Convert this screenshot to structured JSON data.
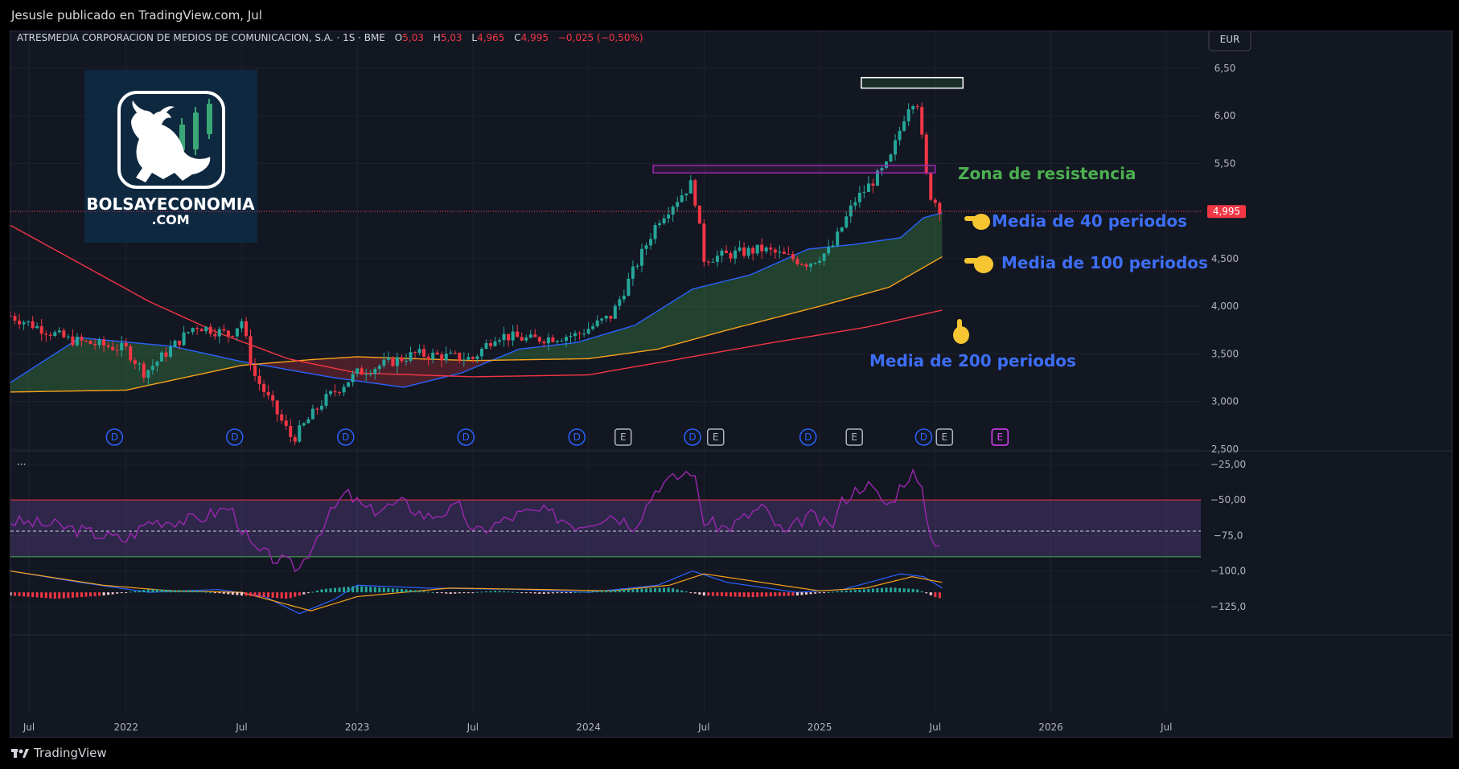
{
  "header": {
    "caption": "Jesusle publicado en TradingView.com, Jul"
  },
  "footer": {
    "brand": "TradingView"
  },
  "legend": {
    "symbol": "ATRESMEDIA CORPORACION DE MEDIOS DE COMUNICACION, S.A. · 1S · BME",
    "o_label": "O",
    "o_val": "5,03",
    "h_label": "H",
    "h_val": "5,03",
    "l_label": "L",
    "l_val": "4,965",
    "c_label": "C",
    "c_val": "4,995",
    "change": "−0,025 (−0,50%)"
  },
  "currency": "EUR",
  "last_price_label": "4,995",
  "watermark": {
    "line1": "BOLSAYECONOMIA",
    "line2": ".COM"
  },
  "annotations": {
    "resistance": "Zona de resistencia",
    "ma40": "Media de 40 periodos",
    "ma100": "Media de 100 periodos",
    "ma200": "Media de 200 periodos"
  },
  "osc": {
    "dots": "···"
  },
  "colors": {
    "bg": "#131722",
    "up": "#26a69a",
    "down": "#f23645",
    "ma40": "#2962ff",
    "ma100": "#f7a21b",
    "ma200": "#f23645",
    "rsi": "#9c27b0",
    "annotation_blue": "#3d6ef5",
    "annotation_green": "#4caf50"
  },
  "chart_data": [
    {
      "type": "candlestick",
      "title": "ATRESMEDIA CORPORACION DE MEDIOS DE COMUNICACION, S.A. · 1S · BME",
      "x_axis": {
        "ticks": [
          "Jul",
          "2022",
          "Jul",
          "2023",
          "Jul",
          "2024",
          "Jul",
          "2025",
          "Jul",
          "2026",
          "Jul"
        ]
      },
      "y_axis": {
        "ticks": [
          "6,50",
          "6,00",
          "5,50",
          "5,00",
          "4,500",
          "4,000",
          "3,500",
          "3,000",
          "2,500"
        ],
        "range": [
          2.5,
          6.65
        ]
      },
      "anchors": [
        {
          "x": 2021.5,
          "close": 3.9
        },
        {
          "x": 2021.75,
          "close": 3.65
        },
        {
          "x": 2022.0,
          "close": 3.55
        },
        {
          "x": 2022.08,
          "close": 3.3
        },
        {
          "x": 2022.3,
          "close": 3.8
        },
        {
          "x": 2022.45,
          "close": 3.7
        },
        {
          "x": 2022.5,
          "close": 3.85
        },
        {
          "x": 2022.55,
          "close": 3.3
        },
        {
          "x": 2022.72,
          "close": 2.6
        },
        {
          "x": 2022.85,
          "close": 3.0
        },
        {
          "x": 2023.0,
          "close": 3.3
        },
        {
          "x": 2023.25,
          "close": 3.5
        },
        {
          "x": 2023.5,
          "close": 3.45
        },
        {
          "x": 2023.6,
          "close": 3.7
        },
        {
          "x": 2023.75,
          "close": 3.65
        },
        {
          "x": 2023.95,
          "close": 3.7
        },
        {
          "x": 2024.1,
          "close": 3.9
        },
        {
          "x": 2024.3,
          "close": 4.9
        },
        {
          "x": 2024.45,
          "close": 5.3
        },
        {
          "x": 2024.5,
          "close": 4.5
        },
        {
          "x": 2024.75,
          "close": 4.6
        },
        {
          "x": 2024.95,
          "close": 4.45
        },
        {
          "x": 2025.05,
          "close": 4.6
        },
        {
          "x": 2025.15,
          "close": 5.1
        },
        {
          "x": 2025.3,
          "close": 5.5
        },
        {
          "x": 2025.38,
          "close": 6.1
        },
        {
          "x": 2025.42,
          "close": 6.2
        },
        {
          "x": 2025.47,
          "close": 5.2
        },
        {
          "x": 2025.53,
          "close": 4.995
        }
      ],
      "last": {
        "open": 5.03,
        "high": 5.03,
        "low": 4.965,
        "close": 4.995
      },
      "moving_averages": [
        {
          "name": "Media de 40 periodos",
          "color": "#2962ff",
          "points": [
            [
              2021.5,
              3.2
            ],
            [
              2021.8,
              3.67
            ],
            [
              2022.2,
              3.58
            ],
            [
              2022.5,
              3.42
            ],
            [
              2022.9,
              3.25
            ],
            [
              2023.2,
              3.15
            ],
            [
              2023.45,
              3.3
            ],
            [
              2023.7,
              3.55
            ],
            [
              2023.95,
              3.62
            ],
            [
              2024.2,
              3.8
            ],
            [
              2024.45,
              4.18
            ],
            [
              2024.7,
              4.33
            ],
            [
              2024.95,
              4.6
            ],
            [
              2025.15,
              4.65
            ],
            [
              2025.35,
              4.72
            ],
            [
              2025.45,
              4.93
            ],
            [
              2025.53,
              4.98
            ]
          ]
        },
        {
          "name": "Media de 100 periodos",
          "color": "#f7a21b",
          "points": [
            [
              2021.5,
              3.1
            ],
            [
              2022.0,
              3.12
            ],
            [
              2022.5,
              3.38
            ],
            [
              2022.8,
              3.44
            ],
            [
              2023.0,
              3.47
            ],
            [
              2023.5,
              3.43
            ],
            [
              2024.0,
              3.45
            ],
            [
              2024.3,
              3.55
            ],
            [
              2024.6,
              3.75
            ],
            [
              2025.0,
              4.0
            ],
            [
              2025.3,
              4.2
            ],
            [
              2025.53,
              4.52
            ]
          ]
        },
        {
          "name": "Media de 200 periodos",
          "color": "#f23645",
          "points": [
            [
              2021.5,
              4.85
            ],
            [
              2021.8,
              4.45
            ],
            [
              2022.1,
              4.05
            ],
            [
              2022.4,
              3.72
            ],
            [
              2022.7,
              3.45
            ],
            [
              2023.0,
              3.3
            ],
            [
              2023.5,
              3.26
            ],
            [
              2024.0,
              3.28
            ],
            [
              2024.4,
              3.45
            ],
            [
              2024.8,
              3.62
            ],
            [
              2025.2,
              3.78
            ],
            [
              2025.53,
              3.96
            ]
          ]
        }
      ],
      "zones": [
        {
          "label": "Zona de resistencia",
          "y_low": 5.4,
          "y_high": 5.48,
          "x_start": 2024.28,
          "x_end": 2025.5
        },
        {
          "label": "",
          "y_low": 6.29,
          "y_high": 6.4,
          "x_start": 2025.18,
          "x_end": 2025.62
        }
      ],
      "event_markers": [
        {
          "label": "D",
          "x": 2021.95
        },
        {
          "label": "D",
          "x": 2022.47
        },
        {
          "label": "D",
          "x": 2022.95
        },
        {
          "label": "D",
          "x": 2023.47
        },
        {
          "label": "D",
          "x": 2023.95
        },
        {
          "label": "E",
          "x": 2024.15
        },
        {
          "label": "D",
          "x": 2024.45
        },
        {
          "label": "E",
          "x": 2024.55
        },
        {
          "label": "D",
          "x": 2024.95
        },
        {
          "label": "E",
          "x": 2025.15
        },
        {
          "label": "D",
          "x": 2025.45
        },
        {
          "label": "E",
          "x": 2025.54
        },
        {
          "label": "E",
          "x": 2025.78
        }
      ]
    },
    {
      "type": "line",
      "title": "",
      "y_axis": {
        "ticks": [
          "−25,00",
          "−50,00",
          "−75,0",
          "−100,0",
          "−125,0"
        ],
        "range": [
          -133,
          -20
        ]
      },
      "bands": {
        "upper": -50,
        "middle": -72,
        "lower": -90
      },
      "series": [
        {
          "points": [
            [
              2021.5,
              -65
            ],
            [
              2021.7,
              -68
            ],
            [
              2021.9,
              -75
            ],
            [
              2022.0,
              -78
            ],
            [
              2022.1,
              -65
            ],
            [
              2022.3,
              -64
            ],
            [
              2022.45,
              -55
            ],
            [
              2022.5,
              -70
            ],
            [
              2022.55,
              -85
            ],
            [
              2022.7,
              -95
            ],
            [
              2022.75,
              -98
            ],
            [
              2022.85,
              -68
            ],
            [
              2022.95,
              -45
            ],
            [
              2023.05,
              -58
            ],
            [
              2023.2,
              -52
            ],
            [
              2023.3,
              -62
            ],
            [
              2023.45,
              -55
            ],
            [
              2023.5,
              -74
            ],
            [
              2023.7,
              -60
            ],
            [
              2023.8,
              -58
            ],
            [
              2023.9,
              -64
            ],
            [
              2023.95,
              -68
            ],
            [
              2024.1,
              -60
            ],
            [
              2024.2,
              -68
            ],
            [
              2024.3,
              -40
            ],
            [
              2024.4,
              -33
            ],
            [
              2024.45,
              -28
            ],
            [
              2024.5,
              -65
            ],
            [
              2024.6,
              -70
            ],
            [
              2024.75,
              -55
            ],
            [
              2024.85,
              -75
            ],
            [
              2024.95,
              -60
            ],
            [
              2025.05,
              -70
            ],
            [
              2025.1,
              -50
            ],
            [
              2025.2,
              -38
            ],
            [
              2025.3,
              -55
            ],
            [
              2025.35,
              -40
            ],
            [
              2025.4,
              -30
            ],
            [
              2025.45,
              -48
            ],
            [
              2025.48,
              -77
            ],
            [
              2025.53,
              -80
            ]
          ]
        }
      ]
    },
    {
      "type": "bar",
      "title": "",
      "y_axis": {
        "ticks": [
          "−100,0",
          "−125,0"
        ]
      },
      "series": [
        {
          "points": [
            [
              2021.5,
              -100
            ],
            [
              2021.8,
              -108
            ],
            [
              2022.1,
              -115
            ],
            [
              2022.4,
              -113
            ],
            [
              2022.6,
              -118
            ],
            [
              2022.75,
              -130
            ],
            [
              2022.9,
              -120
            ],
            [
              2023.0,
              -110
            ],
            [
              2023.3,
              -112
            ],
            [
              2023.7,
              -113
            ],
            [
              2024.0,
              -115
            ],
            [
              2024.3,
              -110
            ],
            [
              2024.45,
              -100
            ],
            [
              2024.6,
              -108
            ],
            [
              2024.9,
              -115
            ],
            [
              2025.1,
              -113
            ],
            [
              2025.35,
              -102
            ],
            [
              2025.45,
              -104
            ],
            [
              2025.53,
              -112
            ]
          ]
        },
        {
          "points": [
            [
              2021.5,
              -100
            ],
            [
              2021.9,
              -110
            ],
            [
              2022.2,
              -114
            ],
            [
              2022.5,
              -115
            ],
            [
              2022.8,
              -128
            ],
            [
              2023.0,
              -118
            ],
            [
              2023.4,
              -112
            ],
            [
              2023.8,
              -113
            ],
            [
              2024.1,
              -114
            ],
            [
              2024.35,
              -110
            ],
            [
              2024.5,
              -102
            ],
            [
              2024.75,
              -108
            ],
            [
              2025.0,
              -114
            ],
            [
              2025.2,
              -112
            ],
            [
              2025.4,
              -104
            ],
            [
              2025.53,
              -108
            ]
          ]
        }
      ],
      "histogram": [
        [
          2021.5,
          -1
        ],
        [
          2021.7,
          -2
        ],
        [
          2021.9,
          -1
        ],
        [
          2022.1,
          1
        ],
        [
          2022.3,
          0.5
        ],
        [
          2022.5,
          -1
        ],
        [
          2022.7,
          -2
        ],
        [
          2022.85,
          1
        ],
        [
          2023.0,
          2
        ],
        [
          2023.2,
          1
        ],
        [
          2023.4,
          -0.5
        ],
        [
          2023.6,
          0.5
        ],
        [
          2023.8,
          -0.5
        ],
        [
          2024.0,
          0.3
        ],
        [
          2024.2,
          1
        ],
        [
          2024.35,
          1.5
        ],
        [
          2024.5,
          -1
        ],
        [
          2024.7,
          -1.5
        ],
        [
          2024.9,
          -1
        ],
        [
          2025.1,
          0.5
        ],
        [
          2025.3,
          1.5
        ],
        [
          2025.42,
          1
        ],
        [
          2025.5,
          -1.5
        ],
        [
          2025.53,
          -2
        ]
      ]
    }
  ]
}
